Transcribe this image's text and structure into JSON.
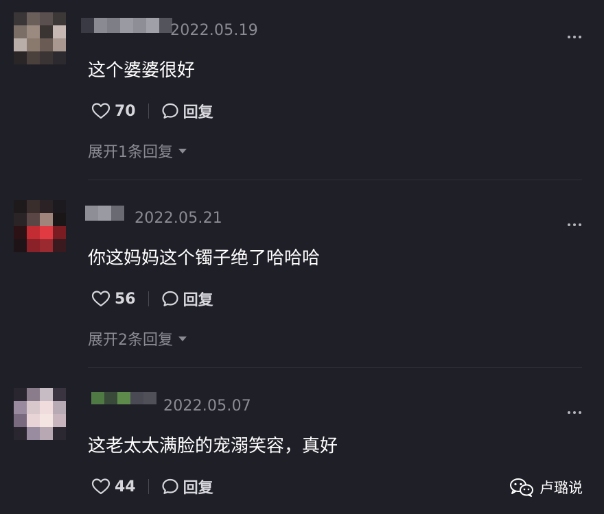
{
  "comments": [
    {
      "date": "2022.05.19",
      "text": "这个婆婆很好",
      "likes": "70",
      "reply_label": "回复",
      "expand_label": "展开1条回复"
    },
    {
      "date": "2022.05.21",
      "text": "你这妈妈这个镯子绝了哈哈哈",
      "likes": "56",
      "reply_label": "回复",
      "expand_label": "展开2条回复"
    },
    {
      "date": "2022.05.07",
      "text": "这老太太满脸的宠溺笑容，真好",
      "likes": "44",
      "reply_label": "回复"
    }
  ],
  "watermark": {
    "icon": "wechat-icon",
    "text": "卢璐说"
  },
  "colors": {
    "background": "#1f1f27",
    "secondary_text": "#8b8b93",
    "primary_text": "#ffffff"
  }
}
